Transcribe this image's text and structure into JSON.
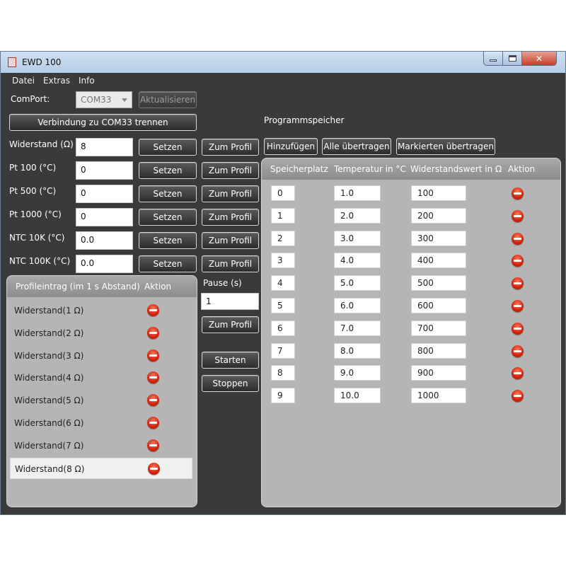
{
  "window": {
    "title": "EWD 100",
    "min_label": "",
    "max_label": "",
    "close_label": "✕"
  },
  "menu": [
    "Datei",
    "Extras",
    "Info"
  ],
  "comport": {
    "label": "ComPort:",
    "value": "COM33",
    "refresh_label": "Aktualisieren"
  },
  "connection_button": "Verbindung zu COM33 trennen",
  "program_memory_title": "Programmspeicher",
  "settings": [
    {
      "label": "Widerstand (Ω)",
      "value": "8"
    },
    {
      "label": "Pt 100 (°C)",
      "value": "0"
    },
    {
      "label": "Pt 500 (°C)",
      "value": "0"
    },
    {
      "label": "Pt 1000 (°C)",
      "value": "0"
    },
    {
      "label": "NTC 10K (°C)",
      "value": "0.0"
    },
    {
      "label": "NTC 100K (°C)",
      "value": "0.0"
    }
  ],
  "set_label": "Setzen",
  "to_profile_label": "Zum Profil",
  "pause": {
    "label": "Pause (s)",
    "value": "1",
    "to_profile_label": "Zum Profil"
  },
  "start_label": "Starten",
  "stop_label": "Stoppen",
  "toolbar": {
    "add": "Hinzufügen",
    "transfer_all": "Alle übertragen",
    "transfer_selected": "Markierten übertragen"
  },
  "profile": {
    "headers": {
      "entry": "Profileintrag (im 1 s Abstand)",
      "action": "Aktion"
    },
    "rows": [
      "Widerstand(1 Ω)",
      "Widerstand(2 Ω)",
      "Widerstand(3 Ω)",
      "Widerstand(4 Ω)",
      "Widerstand(5 Ω)",
      "Widerstand(6 Ω)",
      "Widerstand(7 Ω)",
      "Widerstand(8 Ω)"
    ],
    "selected_index": 7
  },
  "memory": {
    "headers": {
      "slot": "Speicherplatz",
      "temp": "Temperatur in °C",
      "res": "Widerstandswert in Ω",
      "action": "Aktion"
    },
    "rows": [
      {
        "slot": "0",
        "temp": "1.0",
        "res": "100"
      },
      {
        "slot": "1",
        "temp": "2.0",
        "res": "200"
      },
      {
        "slot": "2",
        "temp": "3.0",
        "res": "300"
      },
      {
        "slot": "3",
        "temp": "4.0",
        "res": "400"
      },
      {
        "slot": "4",
        "temp": "5.0",
        "res": "500"
      },
      {
        "slot": "5",
        "temp": "6.0",
        "res": "600"
      },
      {
        "slot": "6",
        "temp": "7.0",
        "res": "700"
      },
      {
        "slot": "7",
        "temp": "8.0",
        "res": "800"
      },
      {
        "slot": "8",
        "temp": "9.0",
        "res": "900"
      },
      {
        "slot": "9",
        "temp": "10.0",
        "res": "1000"
      }
    ]
  }
}
